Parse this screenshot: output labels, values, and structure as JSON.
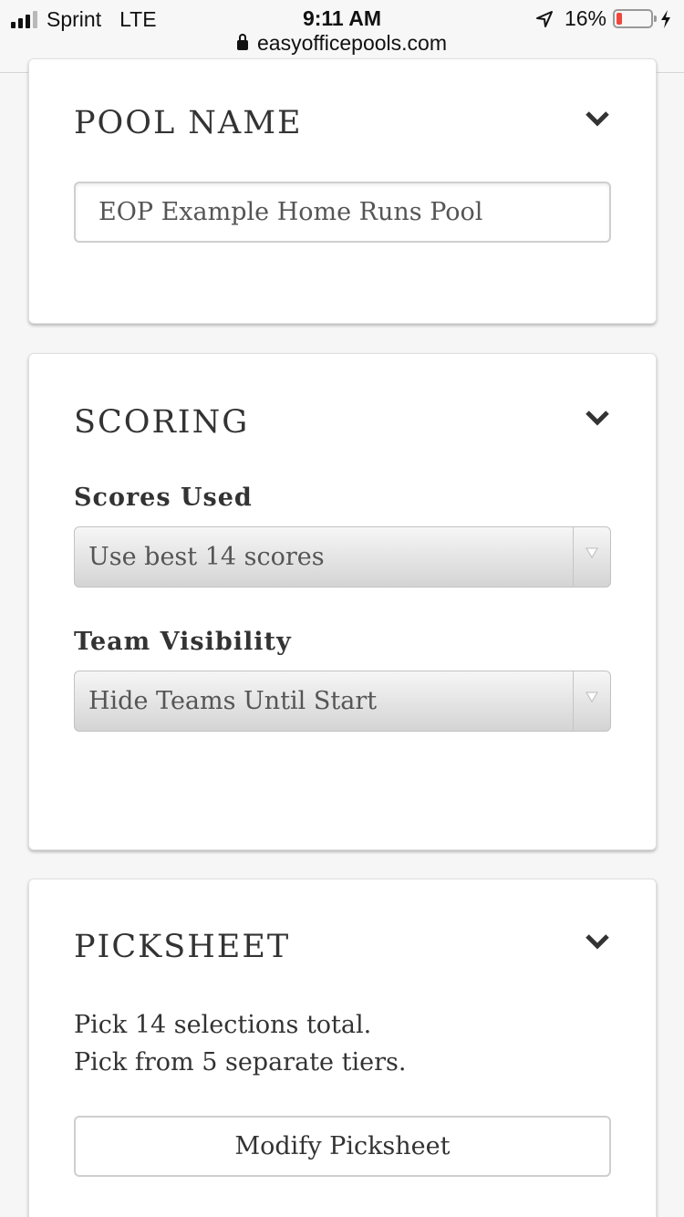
{
  "status_bar": {
    "carrier": "Sprint",
    "network": "LTE",
    "time": "9:11 AM",
    "url": "easyofficepools.com",
    "battery": "16%",
    "battery_level": 0.16,
    "battery_color": "#f0463c"
  },
  "pool_name": {
    "title": "POOL NAME",
    "input_value": "EOP Example Home Runs Pool"
  },
  "scoring": {
    "title": "SCORING",
    "scores_used_label": "Scores Used",
    "scores_used_value": "Use best 14 scores",
    "team_visibility_label": "Team Visibility",
    "team_visibility_value": "Hide Teams Until Start"
  },
  "picksheet": {
    "title": "PICKSHEET",
    "line1": "Pick 14 selections total.",
    "line2": "Pick from 5 separate tiers.",
    "button_label": "Modify Picksheet"
  },
  "icons": {
    "chevron": "chevron-down-icon",
    "lock": "lock-icon",
    "location": "location-arrow-icon",
    "charging": "charging-bolt-icon"
  }
}
